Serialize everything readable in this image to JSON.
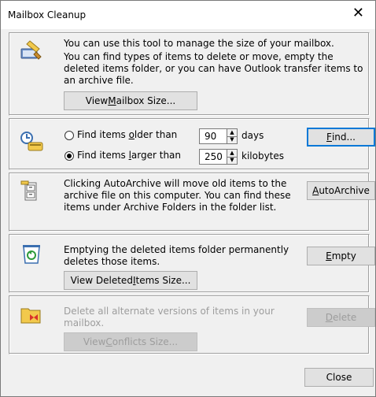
{
  "window": {
    "title": "Mailbox Cleanup",
    "close_glyph": "✕"
  },
  "manage": {
    "line1": "You can use this tool to manage the size of your mailbox.",
    "line2": "You can find types of items to delete or move, empty the deleted items folder, or you can have Outlook transfer items to an archive file.",
    "view_size_pre": "View ",
    "view_size_u": "M",
    "view_size_post": "ailbox Size..."
  },
  "find": {
    "opt1_pre": "Find items ",
    "opt1_u": "o",
    "opt1_post": "lder than",
    "opt1_value": "90",
    "opt1_unit": "days",
    "opt2_pre": "Find items ",
    "opt2_u": "l",
    "opt2_post": "arger than",
    "opt2_value": "250",
    "opt2_unit": "kilobytes",
    "find_pre": "",
    "find_u": "F",
    "find_post": "ind..."
  },
  "archive": {
    "text": "Clicking AutoArchive will move old items to the archive file on this computer. You can find these items under Archive Folders in the folder list.",
    "btn_u": "A",
    "btn_post": "utoArchive"
  },
  "deleted": {
    "text": "Emptying the deleted items folder permanently deletes those items.",
    "empty_u": "E",
    "empty_post": "mpty",
    "view_pre": "View Deleted ",
    "view_u": "I",
    "view_post": "tems Size..."
  },
  "conflicts": {
    "text": "Delete all alternate versions of items in your mailbox.",
    "delete_u": "D",
    "delete_post": "elete",
    "view_pre": "View ",
    "view_u": "C",
    "view_post": "onflicts Size..."
  },
  "footer": {
    "close_label": "Close"
  }
}
